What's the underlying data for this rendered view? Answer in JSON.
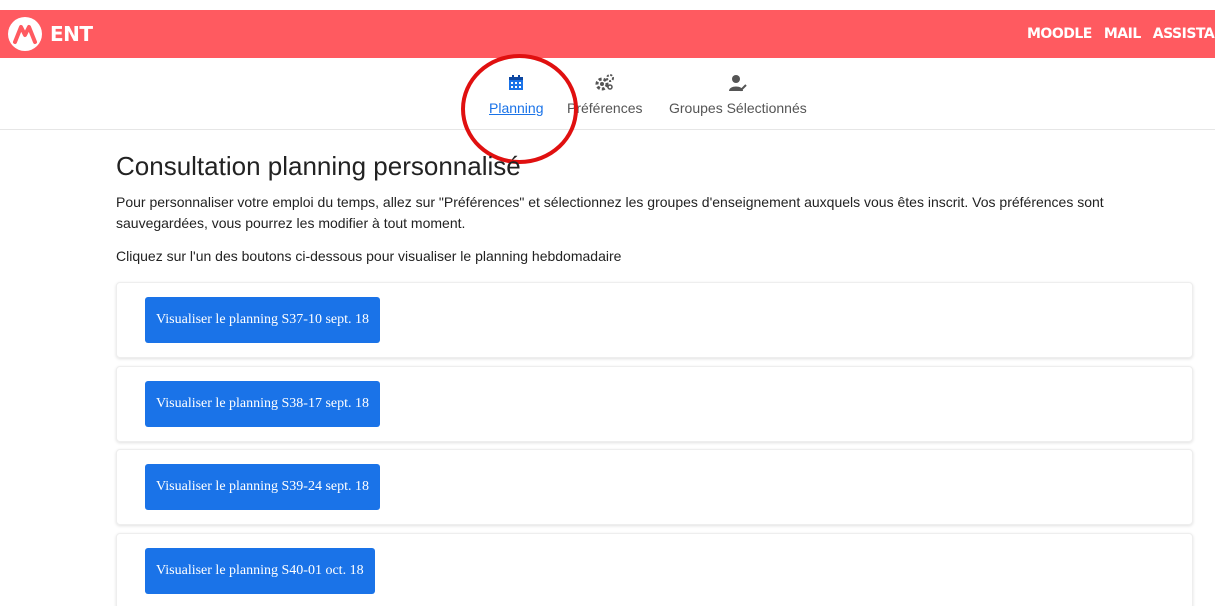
{
  "header": {
    "brand": "ENT",
    "accent_color": "#ff5a60",
    "logo_icon": "logo-icon",
    "links": [
      "MOODLE",
      "MAIL",
      "ASSISTANCE"
    ]
  },
  "subnav": {
    "items": [
      {
        "label": "Planning",
        "icon": "calendar-icon",
        "active": true
      },
      {
        "label": "Préférences",
        "icon": "gears-icon",
        "active": false
      },
      {
        "label": "Groupes Sélectionnés",
        "icon": "user-check-icon",
        "active": false
      }
    ]
  },
  "main": {
    "title": "Consultation planning personnalisé",
    "intro": "Pour personnaliser votre emploi du temps, allez sur \"Préférences\" et sélectionnez les groupes d'enseignement auxquels vous êtes inscrit. Vos préférences sont sauvegardées, vous pourrez les modifier à tout moment.",
    "hint": "Cliquez sur l'un des boutons ci-dessous pour visualiser le planning hebdomadaire",
    "buttons": [
      "Visualiser le planning S37-10 sept. 18",
      "Visualiser le planning S38-17 sept. 18",
      "Visualiser le planning S39-24 sept. 18",
      "Visualiser le planning S40-01 oct. 18"
    ],
    "button_color": "#1a73e8"
  }
}
